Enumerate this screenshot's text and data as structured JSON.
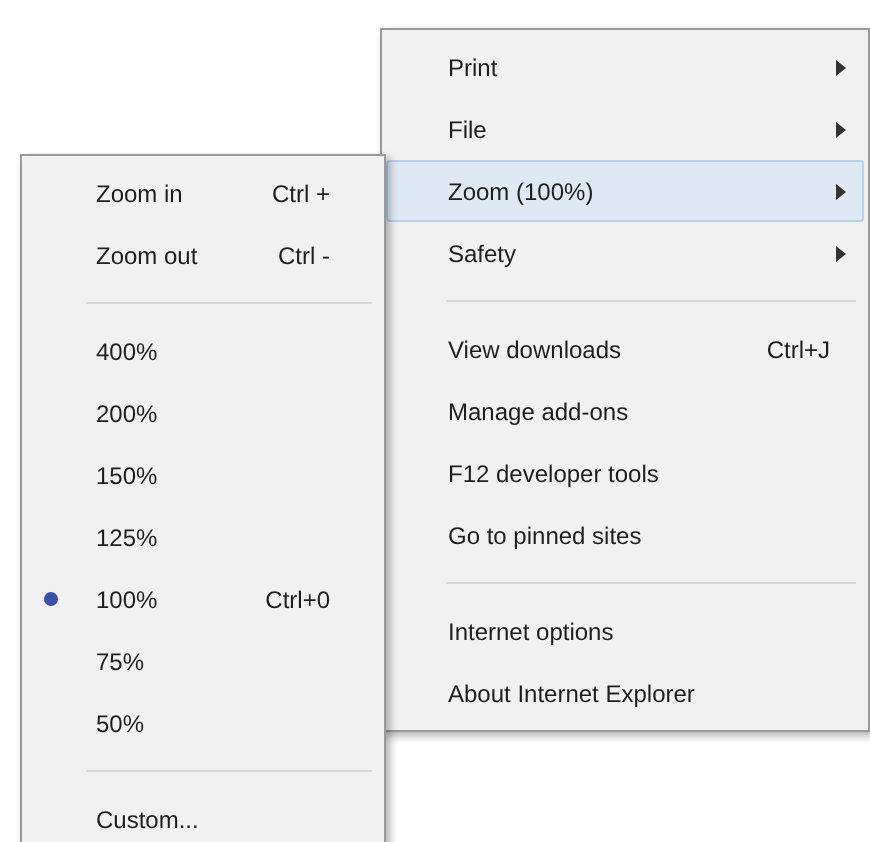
{
  "main_menu": {
    "items": [
      {
        "kind": "item",
        "label": "Print",
        "has_submenu": true,
        "selected": false
      },
      {
        "kind": "item",
        "label": "File",
        "has_submenu": true,
        "selected": false
      },
      {
        "kind": "item",
        "label": "Zoom (100%)",
        "has_submenu": true,
        "selected": true
      },
      {
        "kind": "item",
        "label": "Safety",
        "has_submenu": true,
        "selected": false
      },
      {
        "kind": "separator"
      },
      {
        "kind": "item",
        "label": "View downloads",
        "shortcut": "Ctrl+J",
        "has_submenu": false,
        "selected": false
      },
      {
        "kind": "item",
        "label": "Manage add-ons",
        "has_submenu": false,
        "selected": false
      },
      {
        "kind": "item",
        "label": "F12 developer tools",
        "has_submenu": false,
        "selected": false
      },
      {
        "kind": "item",
        "label": "Go to pinned sites",
        "has_submenu": false,
        "selected": false
      },
      {
        "kind": "separator"
      },
      {
        "kind": "item",
        "label": "Internet options",
        "has_submenu": false,
        "selected": false
      },
      {
        "kind": "item",
        "label": "About Internet Explorer",
        "has_submenu": false,
        "selected": false
      }
    ]
  },
  "zoom_submenu": {
    "items": [
      {
        "kind": "item",
        "label": "Zoom in",
        "shortcut": "Ctrl +",
        "checked": false
      },
      {
        "kind": "item",
        "label": "Zoom out",
        "shortcut": "Ctrl -",
        "checked": false
      },
      {
        "kind": "separator"
      },
      {
        "kind": "item",
        "label": "400%",
        "checked": false
      },
      {
        "kind": "item",
        "label": "200%",
        "checked": false
      },
      {
        "kind": "item",
        "label": "150%",
        "checked": false
      },
      {
        "kind": "item",
        "label": "125%",
        "checked": false
      },
      {
        "kind": "item",
        "label": "100%",
        "shortcut": "Ctrl+0",
        "checked": true
      },
      {
        "kind": "item",
        "label": "75%",
        "checked": false
      },
      {
        "kind": "item",
        "label": "50%",
        "checked": false
      },
      {
        "kind": "separator"
      },
      {
        "kind": "item",
        "label": "Custom...",
        "checked": false
      }
    ]
  }
}
